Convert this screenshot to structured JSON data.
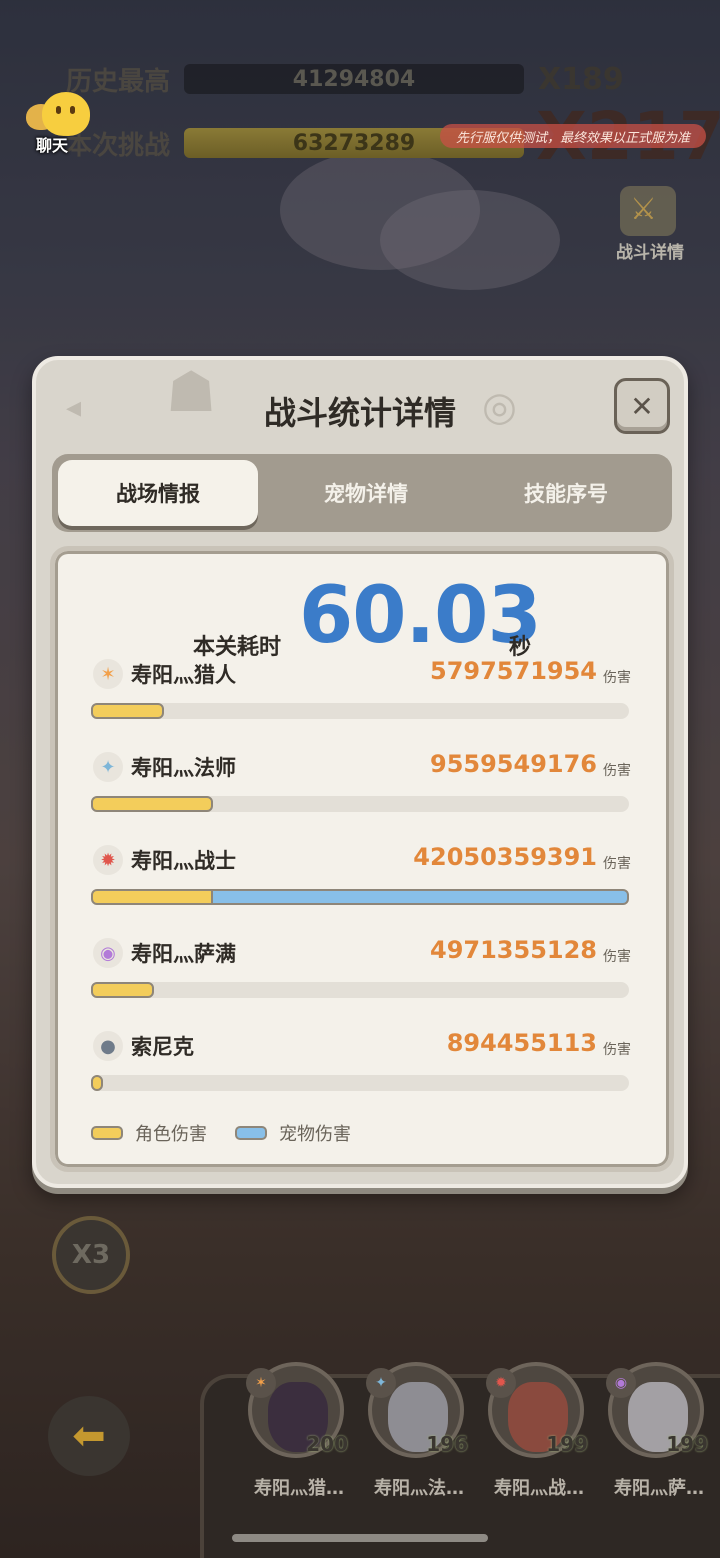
{
  "hud": {
    "best_label": "历史最高",
    "best_value": "41294804",
    "best_multiplier": "X189",
    "current_label": "本次挑战",
    "current_value": "63273289",
    "current_multiplier": "X217",
    "chat_label": "聊天",
    "test_notice": "先行服仅供测试，最终效果以正式服为准",
    "battle_detail_label": "战斗详情"
  },
  "dialog": {
    "title": "战斗统计详情",
    "close_symbol": "✕",
    "tabs": [
      {
        "label": "战场情报",
        "active": true
      },
      {
        "label": "宠物详情",
        "active": false
      },
      {
        "label": "技能序号",
        "active": false
      }
    ],
    "time_label": "本关耗时",
    "time_value": "60.03",
    "time_unit": "秒",
    "damage_unit": "伤害",
    "rows": [
      {
        "name": "寿阳灬猎人",
        "damage": "5797571954",
        "icon": "hunter-icon",
        "icon_glyph": "✶",
        "icon_color": "#f2a04a",
        "char_share": 0.135,
        "pet_share": 0
      },
      {
        "name": "寿阳灬法师",
        "damage": "9559549176",
        "icon": "mage-icon",
        "icon_glyph": "✦",
        "icon_color": "#7eb6d8",
        "char_share": 0.227,
        "pet_share": 0
      },
      {
        "name": "寿阳灬战士",
        "damage": "42050359391",
        "icon": "warrior-icon",
        "icon_glyph": "✹",
        "icon_color": "#e0564c",
        "char_share": 0.227,
        "pet_share": 0.773
      },
      {
        "name": "寿阳灬萨满",
        "damage": "4971355128",
        "icon": "shaman-icon",
        "icon_glyph": "◉",
        "icon_color": "#b27ad8",
        "char_share": 0.118,
        "pet_share": 0
      },
      {
        "name": "索尼克",
        "damage": "894455113",
        "icon": "pet-icon",
        "icon_glyph": "●",
        "icon_color": "#6f7b8a",
        "char_share": 0.021,
        "pet_share": 0
      }
    ],
    "legend": [
      {
        "label": "角色伤害",
        "color": "#f3cd5b"
      },
      {
        "label": "宠物伤害",
        "color": "#88bfe8"
      }
    ]
  },
  "bottom": {
    "speed_label": "X3",
    "back_glyph": "⬅",
    "heroes": [
      {
        "name": "寿阳灬猎…",
        "level": "200",
        "badge_glyph": "✶",
        "badge_color": "#f2a04a",
        "face_color": "#3b2e3e"
      },
      {
        "name": "寿阳灬法…",
        "level": "196",
        "badge_glyph": "✦",
        "badge_color": "#7eb6d8",
        "face_color": "#8e8d93"
      },
      {
        "name": "寿阳灬战…",
        "level": "199",
        "badge_glyph": "✹",
        "badge_color": "#e0564c",
        "face_color": "#8a4a3e"
      },
      {
        "name": "寿阳灬萨…",
        "level": "199",
        "badge_glyph": "◉",
        "badge_color": "#b27ad8",
        "face_color": "#a3a0a4"
      }
    ]
  }
}
